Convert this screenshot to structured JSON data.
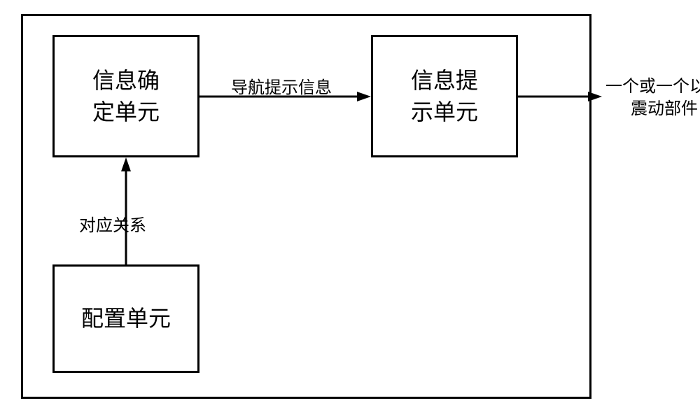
{
  "boxes": {
    "info_confirm": "信息确\n定单元",
    "info_prompt": "信息提\n示单元",
    "config": "配置单元"
  },
  "labels": {
    "nav_info": "导航提示信息",
    "relation": "对应关系",
    "output_line1": "一个或一个以上",
    "output_line2": "震动部件"
  }
}
